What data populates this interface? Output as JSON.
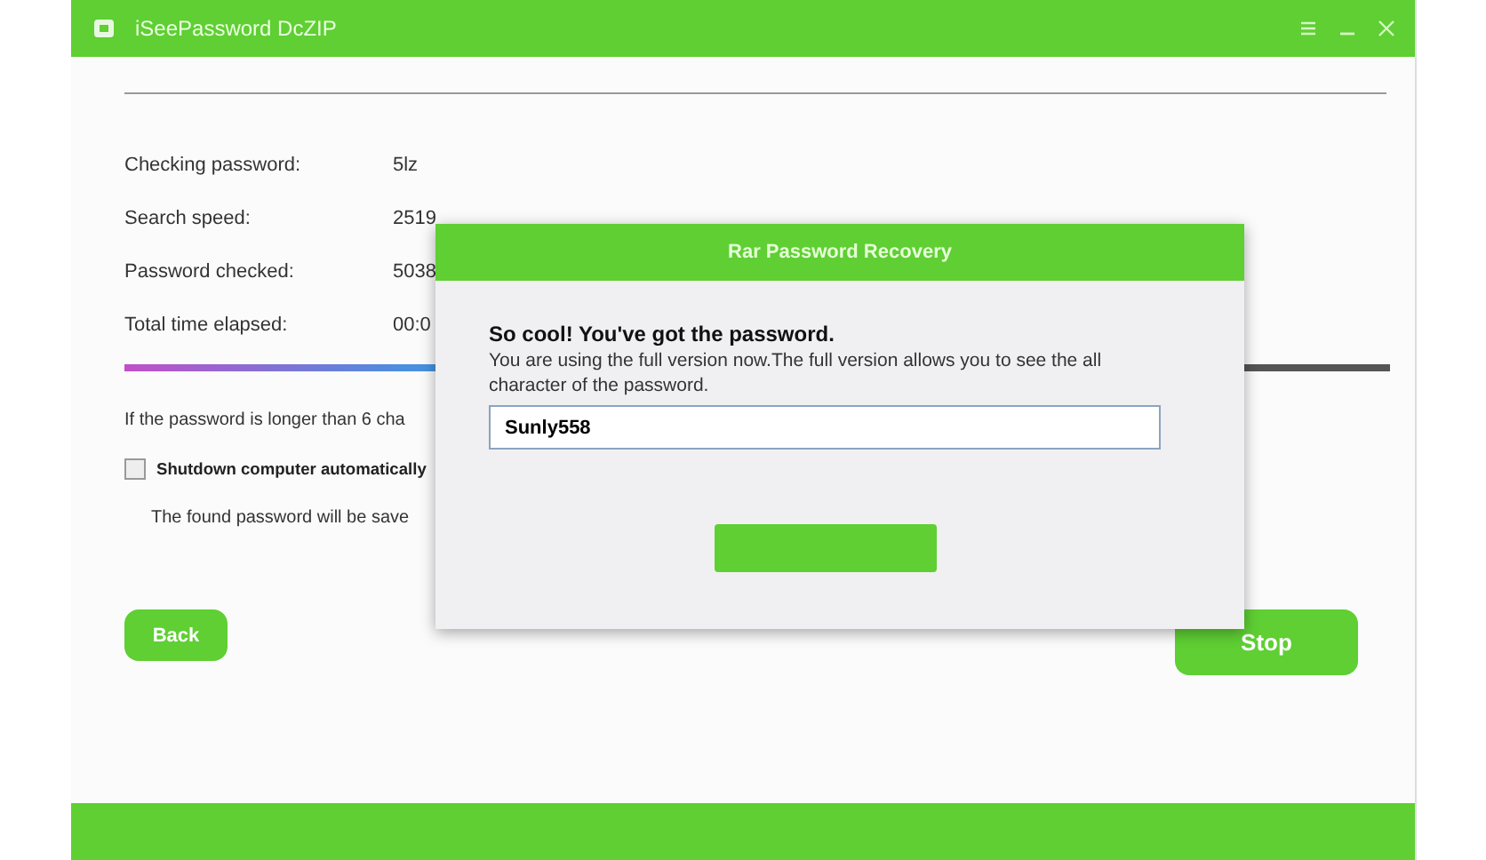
{
  "window": {
    "title": "iSeePassword DcZIP"
  },
  "stats": [
    {
      "label": "Checking password:",
      "value": "5lz"
    },
    {
      "label": "Search speed:",
      "value": "2519"
    },
    {
      "label": "Password checked:",
      "value": "5038"
    },
    {
      "label": "Total time elapsed:",
      "value": "00:0"
    }
  ],
  "progress": {
    "level": 0.45
  },
  "hint": "If the password is longer than 6 cha",
  "shutdown": {
    "label": "Shutdown computer automatically",
    "checked": false
  },
  "save_note": "The found password will be save",
  "buttons": {
    "back": "Back",
    "stop": "Stop"
  },
  "dialog": {
    "title": "Rar Password Recovery",
    "heading": "So cool! You've got the password.",
    "message": "You are using the full version now.The full version allows you to see the all character of the password.",
    "password": "Sunly558"
  }
}
